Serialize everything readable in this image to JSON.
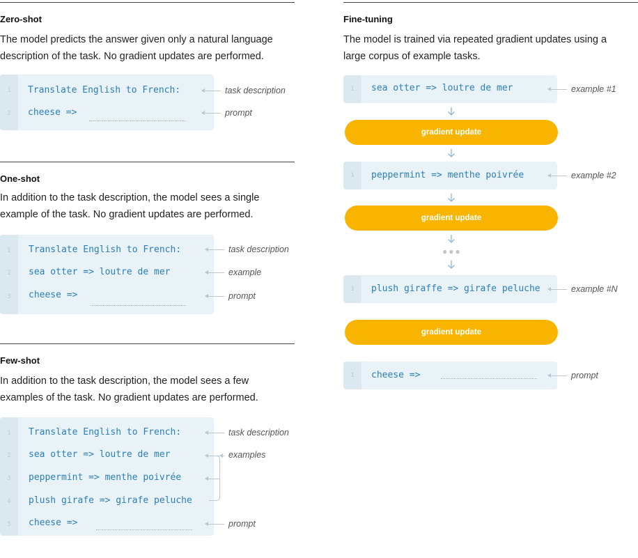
{
  "zero_shot": {
    "title": "Zero-shot",
    "description_line1": "The model predicts the answer given only a natural language",
    "description_line2": "description of the task. No gradient updates are performed.",
    "lines": [
      {
        "num": "1",
        "code": "Translate English to French:",
        "annotation": "task description"
      },
      {
        "num": "2",
        "code": "cheese =>",
        "annotation": "prompt"
      }
    ]
  },
  "one_shot": {
    "title": "One-shot",
    "description_line1": "In addition to the task description, the model sees a single",
    "description_line2": "example of the task. No gradient updates are performed.",
    "lines": [
      {
        "num": "1",
        "code": "Translate English to French:",
        "annotation": "task description"
      },
      {
        "num": "2",
        "code": "sea otter => loutre de mer",
        "annotation": "example"
      },
      {
        "num": "3",
        "code": "cheese =>",
        "annotation": "prompt"
      }
    ]
  },
  "few_shot": {
    "title": "Few-shot",
    "description_line1": "In addition to the task description, the model sees a few",
    "description_line2": "examples of the task. No gradient updates are performed.",
    "lines": [
      {
        "num": "1",
        "code": "Translate English to French:",
        "annotation": "task description"
      },
      {
        "num": "2",
        "code": "sea otter => loutre de mer",
        "annotation": "examples"
      },
      {
        "num": "3",
        "code": "peppermint => menthe poivrée"
      },
      {
        "num": "4",
        "code": "plush girafe => girafe peluche"
      },
      {
        "num": "5",
        "code": "cheese =>",
        "annotation": "prompt"
      }
    ]
  },
  "fine_tuning": {
    "title": "Fine-tuning",
    "description_line1": "The model is trained via repeated gradient updates using a",
    "description_line2": "large corpus of example tasks.",
    "examples": [
      {
        "num": "1",
        "code": "sea otter => loutre de mer",
        "annotation": "example #1"
      },
      {
        "num": "1",
        "code": "peppermint => menthe poivrée",
        "annotation": "example #2"
      },
      {
        "num": "1",
        "code": "plush giraffe => girafe peluche",
        "annotation": "example #N"
      }
    ],
    "gradient_label": "gradient update",
    "prompt": {
      "num": "1",
      "code": "cheese =>",
      "annotation": "prompt"
    }
  },
  "colors": {
    "code_bg": "#e9f2f7",
    "gutter_bg": "#dbe8ef",
    "code_text": "#2a7fb8",
    "pill": "#f9b400"
  }
}
